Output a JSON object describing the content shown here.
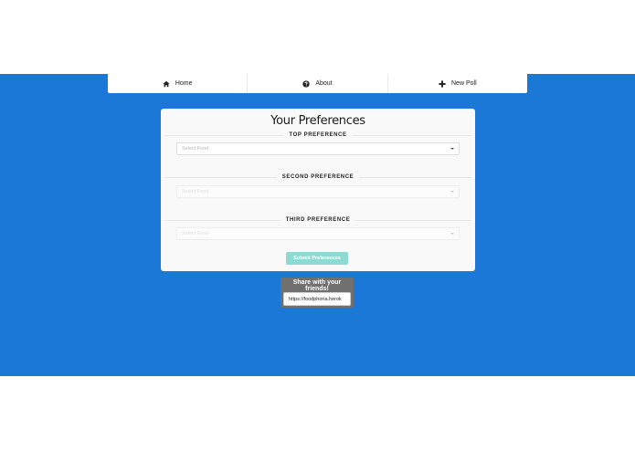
{
  "nav": {
    "items": [
      {
        "label": "Home",
        "icon": "home-icon"
      },
      {
        "label": "About",
        "icon": "question-circle-icon"
      },
      {
        "label": "New Poll",
        "icon": "plus-icon"
      }
    ]
  },
  "card": {
    "title": "Your Preferences",
    "preferences": [
      {
        "heading": "TOP PREFERENCE",
        "placeholder": "Select Food"
      },
      {
        "heading": "SECOND PREFERENCE",
        "placeholder": "Select Food"
      },
      {
        "heading": "THIRD PREFERENCE",
        "placeholder": "Select Food"
      }
    ],
    "submit_label": "Submit Preferences"
  },
  "share": {
    "title": "Share with your friends!",
    "link": "https://foodphoria.herok"
  },
  "colors": {
    "background": "#1b78d6",
    "submit_button": "#8fd9d3",
    "share_box": "#707070"
  }
}
